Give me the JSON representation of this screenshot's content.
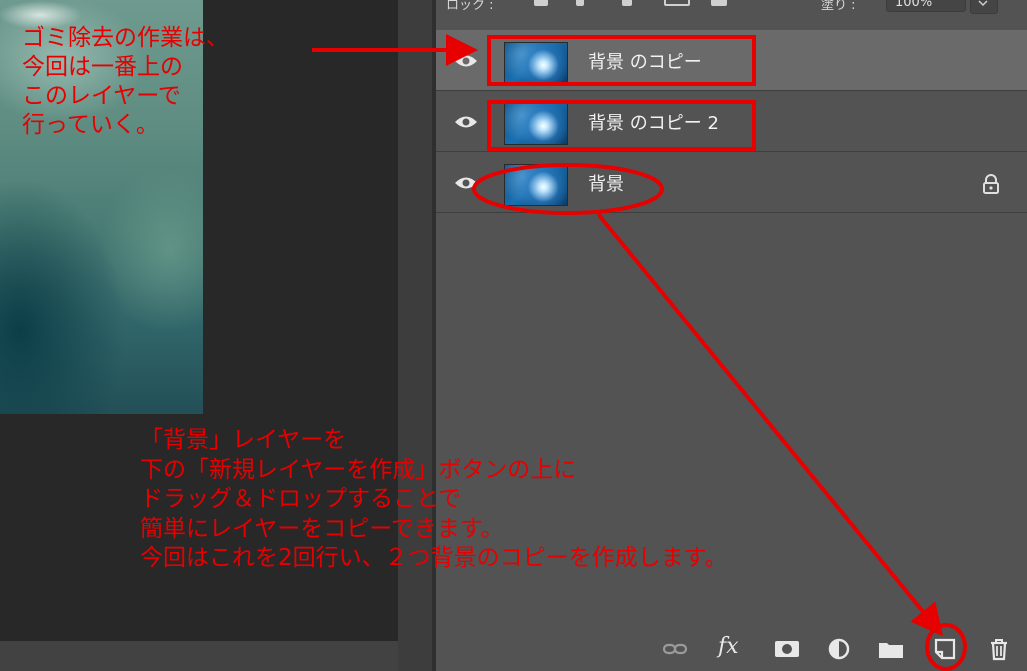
{
  "panel_header": {
    "lock_label": "ロック :",
    "fill_label": "塗り :",
    "fill_value": "100%"
  },
  "layers": [
    {
      "name": "背景 のコピー",
      "visible": true,
      "selected": true,
      "locked": false
    },
    {
      "name": "背景 のコピー 2",
      "visible": true,
      "selected": false,
      "locked": false
    },
    {
      "name": "背景",
      "visible": true,
      "selected": false,
      "locked": true
    }
  ],
  "bottom_toolbar": {
    "icons": [
      "link-layers-icon",
      "fx-icon",
      "add-mask-icon",
      "adjustment-layer-icon",
      "new-group-icon",
      "new-layer-icon",
      "delete-layer-icon"
    ],
    "fx_label": "fx"
  },
  "annotations": {
    "top_lines": [
      "ゴミ除去の作業は、",
      "今回は一番上の",
      "このレイヤーで",
      "行っていく。"
    ],
    "bottom_lines": [
      "「背景」レイヤーを",
      "下の「新規レイヤーを作成」ボタンの上に",
      "ドラッグ＆ドロップすることで",
      "簡単にレイヤーをコピーできます。",
      "今回はこれを2回行い、２つ背景のコピーを作成します。"
    ],
    "color": "#e60000"
  }
}
